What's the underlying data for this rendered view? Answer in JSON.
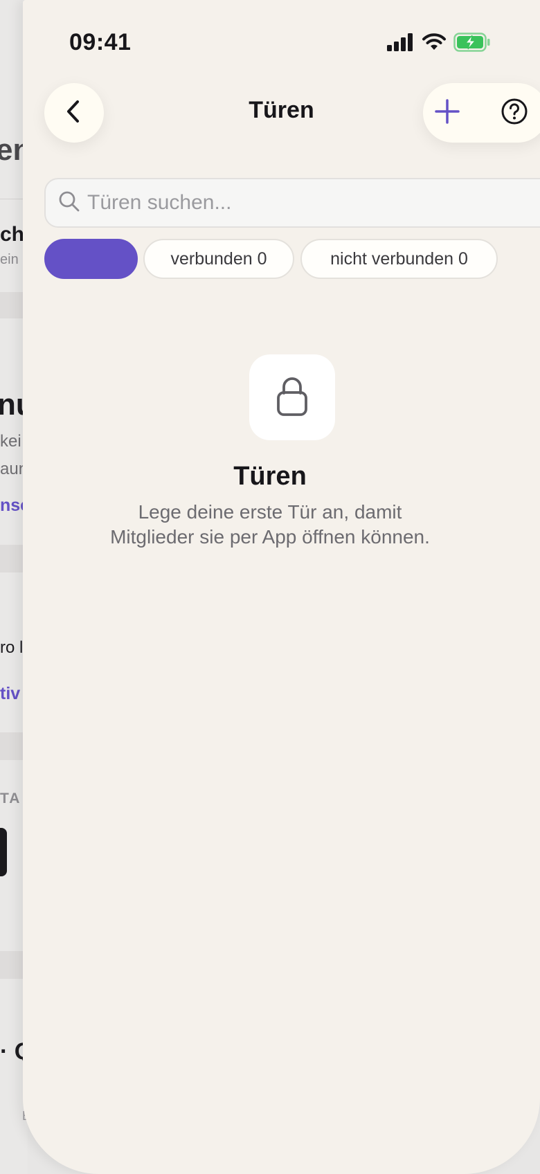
{
  "status_bar": {
    "time": "09:41",
    "icons": [
      "signal-icon",
      "wifi-icon",
      "battery-charging-icon"
    ]
  },
  "background_page": {
    "fragments": [
      "en",
      "ch",
      "ein",
      "nu",
      "kei",
      "aun",
      "nse",
      "ro l",
      "tiv",
      "TA",
      "· Q",
      "E"
    ]
  },
  "header": {
    "title": "Türen",
    "back_icon": "chevron-left-icon",
    "add_icon": "plus-icon",
    "help_icon": "help-circle-icon"
  },
  "search": {
    "placeholder": "Türen suchen...",
    "value": "",
    "icon": "search-icon"
  },
  "filters": {
    "all": {
      "label": "",
      "selected": true
    },
    "connected": {
      "label": "verbunden 0",
      "selected": false
    },
    "disconnected": {
      "label": "nicht verbunden 0",
      "selected": false
    }
  },
  "empty_state": {
    "icon": "lock-icon",
    "title": "Türen",
    "description_line1": "Lege deine erste Tür an, damit",
    "description_line2": "Mitglieder sie per App öffnen können."
  },
  "colors": {
    "accent": "#6451c6",
    "sheet_background": "#f5f1eb",
    "button_background": "#fffcf3",
    "battery_green": "#3ac25b"
  }
}
